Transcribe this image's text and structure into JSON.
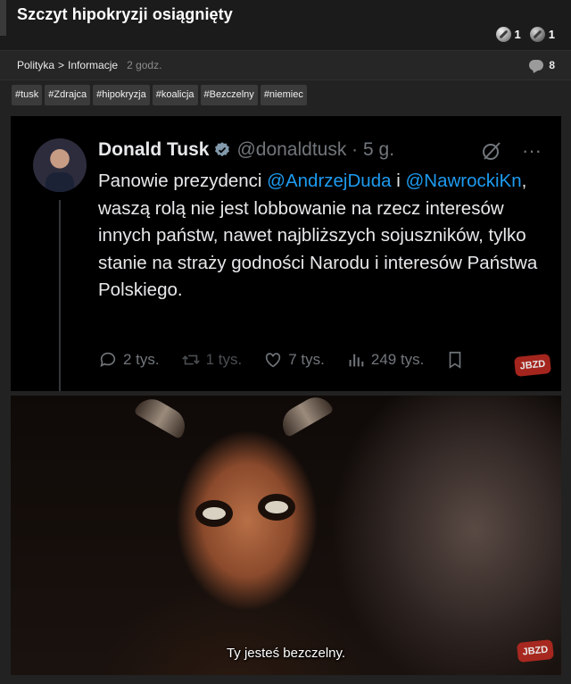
{
  "post": {
    "title": "Szczyt hipokryzji osiągnięty",
    "votes": {
      "up": "1",
      "down": "1"
    },
    "breadcrumb": {
      "category": "Polityka",
      "separator": ">",
      "subcategory": "Informacje",
      "time": "2 godz."
    },
    "comments_count": "8",
    "tags": [
      "#tusk",
      "#Zdrajca",
      "#hipokryzja",
      "#koalicja",
      "#Bezczelny",
      "#niemiec"
    ]
  },
  "tweet": {
    "name": "Donald Tusk",
    "handle": "@donaldtusk · 5 g.",
    "text_parts": {
      "p1": "Panowie prezydenci ",
      "m1": "@AndrzejDuda",
      "p2": " i ",
      "m2": "@NawrockiKn",
      "p3": ", waszą rolą nie jest lobbowanie na rzecz interesów innych państw, nawet najbliższych sojuszników, tylko stanie na straży godności Narodu i interesów Państwa Polskiego."
    },
    "stats": {
      "replies": "2 tys.",
      "reposts": "1 tys.",
      "likes": "7 tys.",
      "views": "249 tys."
    },
    "top_icons": [
      "grok-icon",
      "more-icon"
    ],
    "more_label": "···"
  },
  "meme": {
    "subtitle": "Ty jesteś bezczelny.",
    "watermark": "JBZD"
  },
  "colors": {
    "mention": "#1d9bf0",
    "tweet_bg": "#000000",
    "page_bg": "#222222",
    "tag_bg": "#3b3b3b"
  }
}
